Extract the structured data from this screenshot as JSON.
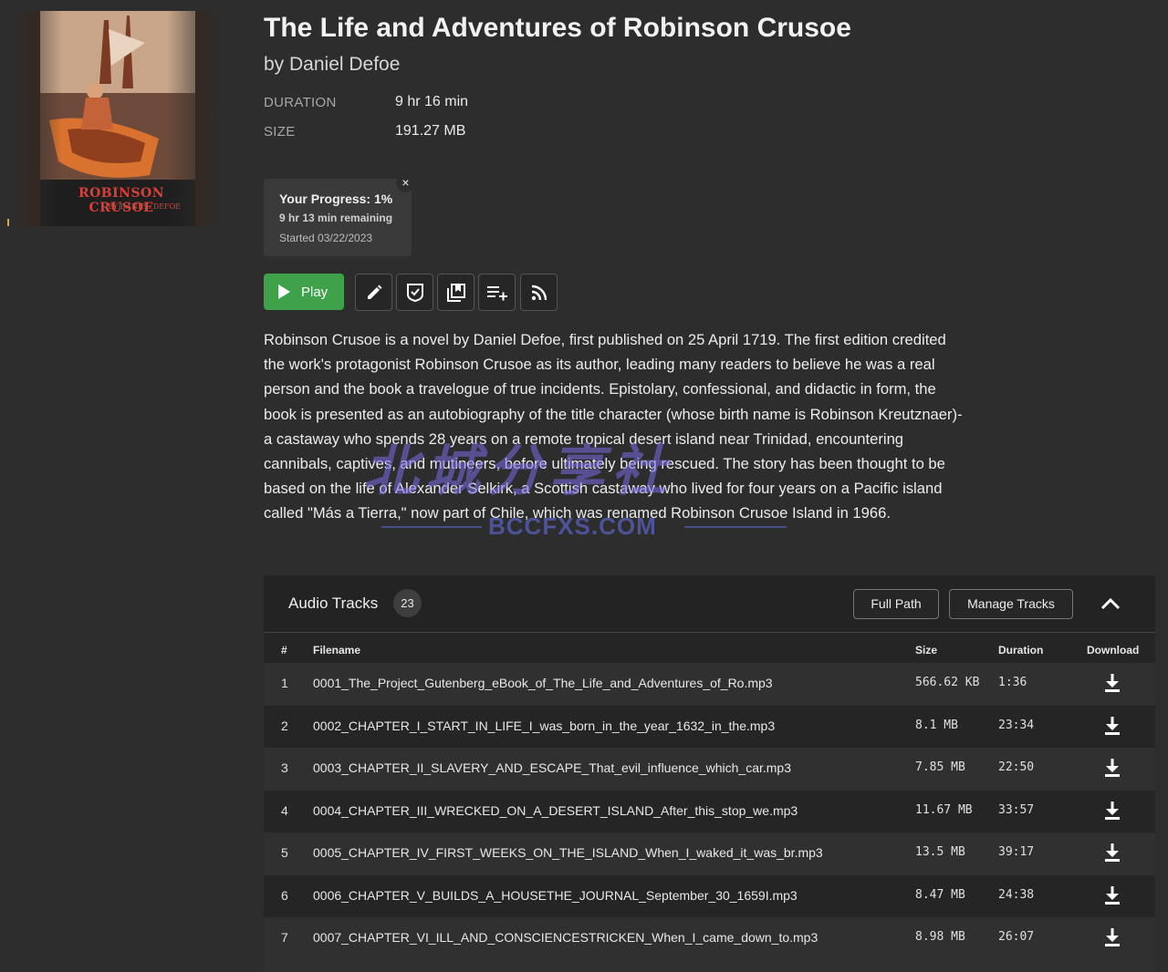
{
  "cover": {
    "title_text": "ROBINSON CRUSOE",
    "author_text": "BY DANIEL DEFOE"
  },
  "book": {
    "title": "The Life and Adventures of Robinson Crusoe",
    "author": "by Daniel Defoe",
    "duration_label": "DURATION",
    "duration_value": "9 hr 16 min",
    "size_label": "SIZE",
    "size_value": "191.27 MB"
  },
  "progress": {
    "heading": "Your Progress: 1%",
    "remaining": "9 hr 13 min remaining",
    "started": "Started 03/22/2023",
    "close_glyph": "×",
    "percent": 1
  },
  "actions": {
    "play_label": "Play",
    "icons": [
      "edit-icon",
      "mark-finished-icon",
      "collections-icon",
      "add-to-playlist-icon",
      "rss-feed-icon"
    ]
  },
  "description": "Robinson Crusoe is a novel by Daniel Defoe, first published on 25 April 1719. The first edition credited the work's protagonist Robinson Crusoe as its author, leading many readers to believe he was a real person and the book a travelogue of true incidents. Epistolary, confessional, and didactic in form, the book is presented as an autobiography of the title character (whose birth name is Robinson Kreutznaer)-a castaway who spends 28 years on a remote tropical desert island near Trinidad, encountering cannibals, captives, and mutineers, before ultimately being rescued. The story has been thought to be based on the life of Alexander Selkirk, a Scottish castaway who lived for four years on a Pacific island called \"Más a Tierra,\" now part of Chile, which was renamed Robinson Crusoe Island in 1966.",
  "watermark": {
    "main": "北城分享社",
    "sub": "BCCFXS.COM"
  },
  "tracks": {
    "title": "Audio Tracks",
    "count": "23",
    "full_path_label": "Full Path",
    "manage_label": "Manage Tracks",
    "columns": {
      "num": "#",
      "filename": "Filename",
      "size": "Size",
      "duration": "Duration",
      "download": "Download"
    },
    "rows": [
      {
        "num": "1",
        "filename": "0001_The_Project_Gutenberg_eBook_of_The_Life_and_Adventures_of_Ro.mp3",
        "size": "566.62 KB",
        "duration": "1:36"
      },
      {
        "num": "2",
        "filename": "0002_CHAPTER_I_START_IN_LIFE_I_was_born_in_the_year_1632_in_the.mp3",
        "size": "8.1 MB",
        "duration": "23:34"
      },
      {
        "num": "3",
        "filename": "0003_CHAPTER_II_SLAVERY_AND_ESCAPE_That_evil_influence_which_car.mp3",
        "size": "7.85 MB",
        "duration": "22:50"
      },
      {
        "num": "4",
        "filename": "0004_CHAPTER_III_WRECKED_ON_A_DESERT_ISLAND_After_this_stop_we.mp3",
        "size": "11.67 MB",
        "duration": "33:57"
      },
      {
        "num": "5",
        "filename": "0005_CHAPTER_IV_FIRST_WEEKS_ON_THE_ISLAND_When_I_waked_it_was_br.mp3",
        "size": "13.5 MB",
        "duration": "39:17"
      },
      {
        "num": "6",
        "filename": "0006_CHAPTER_V_BUILDS_A_HOUSETHE_JOURNAL_September_30_1659I.mp3",
        "size": "8.47 MB",
        "duration": "24:38"
      },
      {
        "num": "7",
        "filename": "0007_CHAPTER_VI_ILL_AND_CONSCIENCESTRICKEN_When_I_came_down_to.mp3",
        "size": "8.98 MB",
        "duration": "26:07"
      }
    ]
  }
}
